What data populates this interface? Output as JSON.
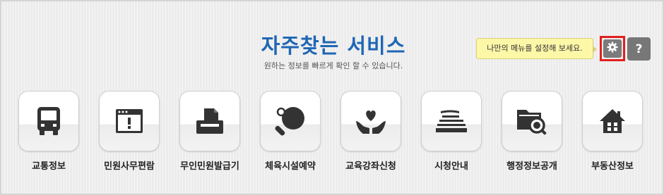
{
  "header": {
    "title": "자주찾는 서비스",
    "subtitle": "원하는 정보를 빠르게 확인 할 수 있습니다."
  },
  "toolbar": {
    "tooltip": "나만의 메뉴를 설정해 보세요.",
    "help_label": "?",
    "settings_icon": "gear-icon"
  },
  "services": [
    {
      "label": "교통정보",
      "icon": "bus-icon"
    },
    {
      "label": "민원사무편람",
      "icon": "browser-alert-icon"
    },
    {
      "label": "무인민원발급기",
      "icon": "printer-icon"
    },
    {
      "label": "체육시설예약",
      "icon": "ping-pong-icon"
    },
    {
      "label": "교육강좌신청",
      "icon": "hands-heart-icon"
    },
    {
      "label": "시청안내",
      "icon": "building-icon"
    },
    {
      "label": "행정정보공개",
      "icon": "folder-search-icon"
    },
    {
      "label": "부동산정보",
      "icon": "house-icon"
    }
  ],
  "colors": {
    "title": "#1f66b4",
    "icon": "#333333",
    "highlight_border": "#e0201d",
    "tooltip_bg": "#fdf7a8"
  }
}
